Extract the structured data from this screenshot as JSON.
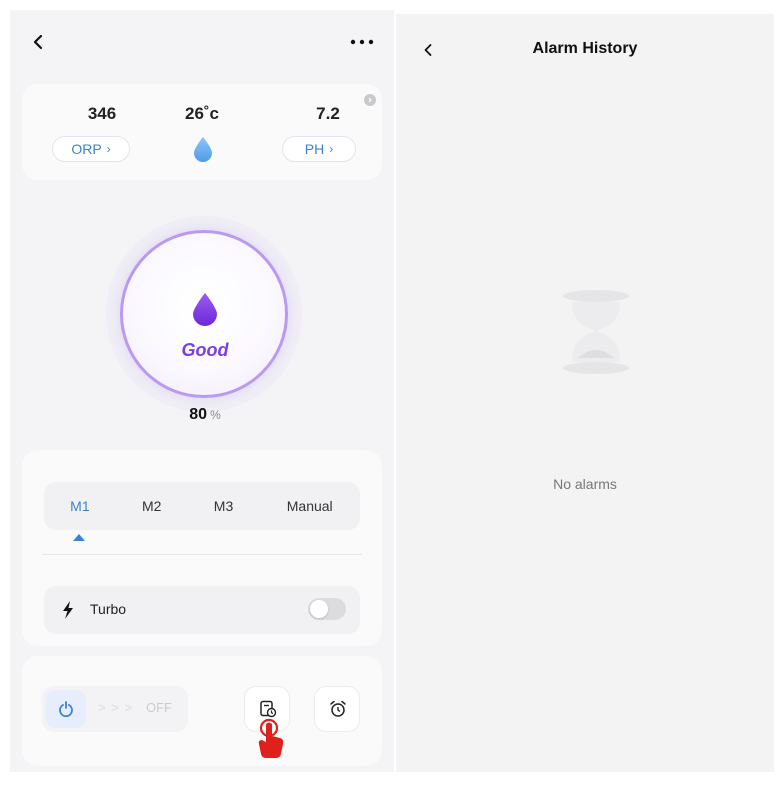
{
  "left_screen": {
    "header": {
      "back_icon": "chevron-left-icon",
      "more_icon": "ellipsis-icon"
    },
    "sensors": {
      "orp": {
        "value": "346",
        "label": "ORP"
      },
      "temperature": {
        "value": "26˚c",
        "icon": "water-drop-icon"
      },
      "ph": {
        "value": "7.2",
        "label": "PH"
      }
    },
    "water_quality": {
      "status": "Good",
      "percent": "80",
      "unit": "%",
      "accent": "#7a3fe0"
    },
    "modes": {
      "tabs": [
        "M1",
        "M2",
        "M3",
        "Manual"
      ],
      "selected": "M1"
    },
    "turbo": {
      "label": "Turbo",
      "enabled": false
    },
    "power": {
      "arrows": "> > >",
      "state": "OFF"
    }
  },
  "right_screen": {
    "title": "Alarm History",
    "back_icon": "chevron-left-icon",
    "empty_icon": "hourglass-icon",
    "empty_message": "No alarms"
  },
  "colors": {
    "accent_blue": "#3b82d6",
    "purple": "#7a3fe0",
    "tap_hint": "#e0201a"
  }
}
